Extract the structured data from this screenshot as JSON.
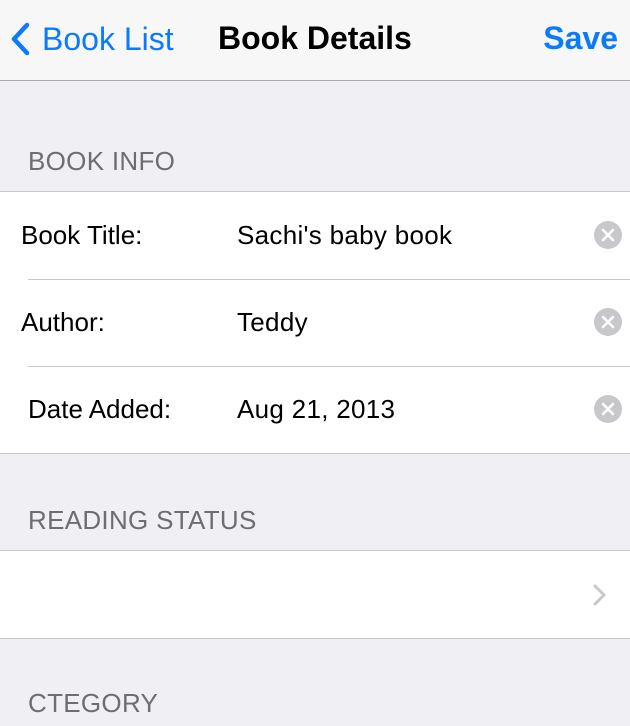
{
  "navbar": {
    "back_label": "Book List",
    "title": "Book Details",
    "save_label": "Save"
  },
  "sections": {
    "book_info": {
      "header": "BOOK INFO",
      "fields": [
        {
          "label": "Book Title:",
          "value": "Sachi's baby book"
        },
        {
          "label": "Author:",
          "value": "Teddy"
        },
        {
          "label": "Date Added:",
          "value": "Aug 21, 2013"
        }
      ]
    },
    "reading_status": {
      "header": "READING STATUS",
      "value": ""
    },
    "category": {
      "header": "CTEGORY"
    }
  },
  "colors": {
    "accent": "#0a7aff",
    "background": "#efeff4",
    "header_text": "#6d6d72",
    "separator": "#c8c7cc",
    "clear_icon": "#c7c7cc"
  },
  "icons": {
    "back": "chevron-left-icon",
    "clear": "clear-circle-x-icon",
    "disclosure": "chevron-right-icon"
  }
}
